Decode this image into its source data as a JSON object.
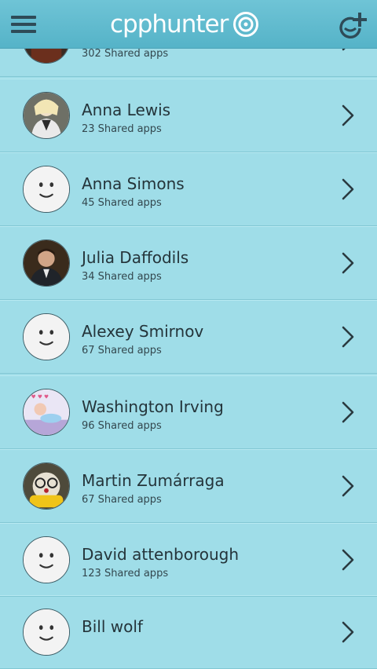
{
  "header": {
    "logo_text": "cpphunter",
    "colors": {
      "bar": "#5fbacd",
      "logo": "#ffffff",
      "icon": "#2e4b57"
    }
  },
  "contacts": [
    {
      "name": "",
      "count": "302 Shared apps",
      "avatar": "photo-1"
    },
    {
      "name": "Anna Lewis",
      "count": "23 Shared apps",
      "avatar": "photo-2"
    },
    {
      "name": "Anna Simons",
      "count": "45 Shared apps",
      "avatar": "smiley"
    },
    {
      "name": "Julia Daffodils",
      "count": "34 Shared apps",
      "avatar": "photo-3"
    },
    {
      "name": "Alexey Smirnov",
      "count": "67 Shared apps",
      "avatar": "smiley"
    },
    {
      "name": "Washington Irving",
      "count": "96 Shared apps",
      "avatar": "photo-4"
    },
    {
      "name": "Martin Zumárraga",
      "count": "67 Shared apps",
      "avatar": "photo-5"
    },
    {
      "name": "David attenborough",
      "count": "123 Shared apps",
      "avatar": "smiley"
    },
    {
      "name": "Bill wolf",
      "count": "",
      "avatar": "smiley"
    }
  ]
}
